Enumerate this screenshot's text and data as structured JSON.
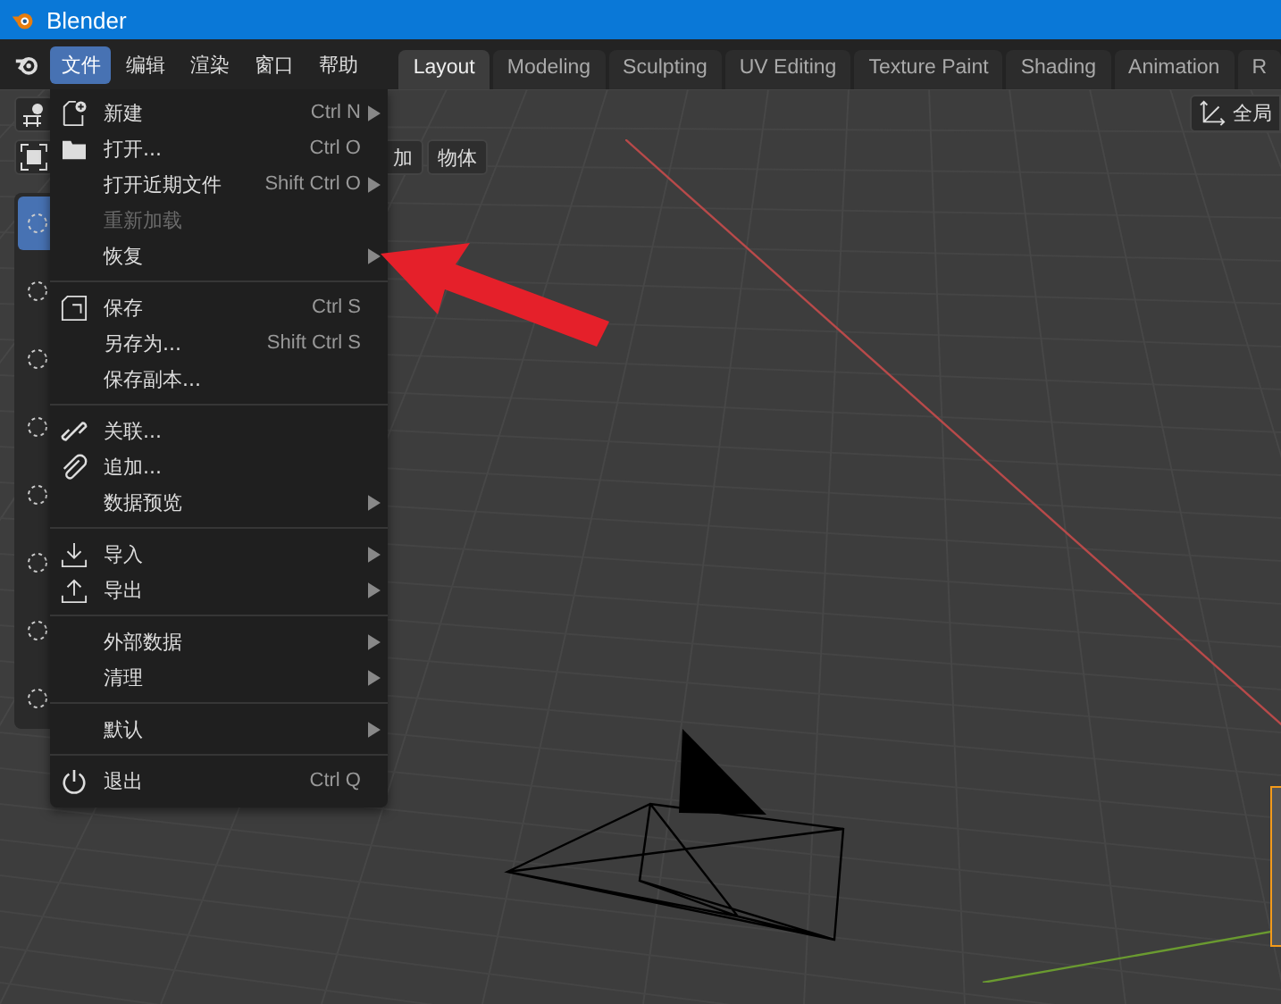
{
  "window": {
    "title": "Blender"
  },
  "menubar": [
    {
      "label": "文件",
      "selected": true
    },
    {
      "label": "编辑",
      "selected": false
    },
    {
      "label": "渲染",
      "selected": false
    },
    {
      "label": "窗口",
      "selected": false
    },
    {
      "label": "帮助",
      "selected": false
    }
  ],
  "tabs": [
    {
      "label": "Layout",
      "selected": true
    },
    {
      "label": "Modeling",
      "selected": false
    },
    {
      "label": "Sculpting",
      "selected": false
    },
    {
      "label": "UV Editing",
      "selected": false
    },
    {
      "label": "Texture Paint",
      "selected": false
    },
    {
      "label": "Shading",
      "selected": false
    },
    {
      "label": "Animation",
      "selected": false
    },
    {
      "label": "R",
      "selected": false
    }
  ],
  "header_buttons": [
    "加",
    "物体"
  ],
  "orientation_button": "全局",
  "toolbar": [
    {
      "selected": true
    },
    {
      "selected": false
    },
    {
      "selected": false
    },
    {
      "selected": false
    },
    {
      "selected": false
    },
    {
      "selected": false
    },
    {
      "selected": false
    },
    {
      "selected": false
    }
  ],
  "file_menu": {
    "sections": [
      [
        {
          "label": "新建",
          "shortcut": "Ctrl N",
          "submenu": true,
          "disabled": false
        },
        {
          "label": "打开...",
          "shortcut": "Ctrl O",
          "submenu": false,
          "disabled": false
        },
        {
          "label": "打开近期文件",
          "shortcut": "Shift Ctrl O",
          "submenu": true,
          "disabled": false
        },
        {
          "label": "重新加载",
          "submenu": false,
          "disabled": true
        },
        {
          "label": "恢复",
          "submenu": true,
          "disabled": false
        }
      ],
      [
        {
          "label": "保存",
          "shortcut": "Ctrl S",
          "submenu": false,
          "disabled": false
        },
        {
          "label": "另存为...",
          "shortcut": "Shift Ctrl S",
          "submenu": false,
          "disabled": false
        },
        {
          "label": "保存副本...",
          "submenu": false,
          "disabled": false
        }
      ],
      [
        {
          "label": "关联...",
          "submenu": false,
          "disabled": false
        },
        {
          "label": "追加...",
          "submenu": false,
          "disabled": false
        },
        {
          "label": "数据预览",
          "submenu": true,
          "disabled": false
        }
      ],
      [
        {
          "label": "导入",
          "submenu": true,
          "disabled": false
        },
        {
          "label": "导出",
          "submenu": true,
          "disabled": false
        }
      ],
      [
        {
          "label": "外部数据",
          "submenu": true,
          "disabled": false
        },
        {
          "label": "清理",
          "submenu": true,
          "disabled": false
        }
      ],
      [
        {
          "label": "默认",
          "submenu": true,
          "disabled": false
        }
      ],
      [
        {
          "label": "退出",
          "shortcut": "Ctrl Q",
          "submenu": false,
          "disabled": false
        }
      ]
    ]
  }
}
